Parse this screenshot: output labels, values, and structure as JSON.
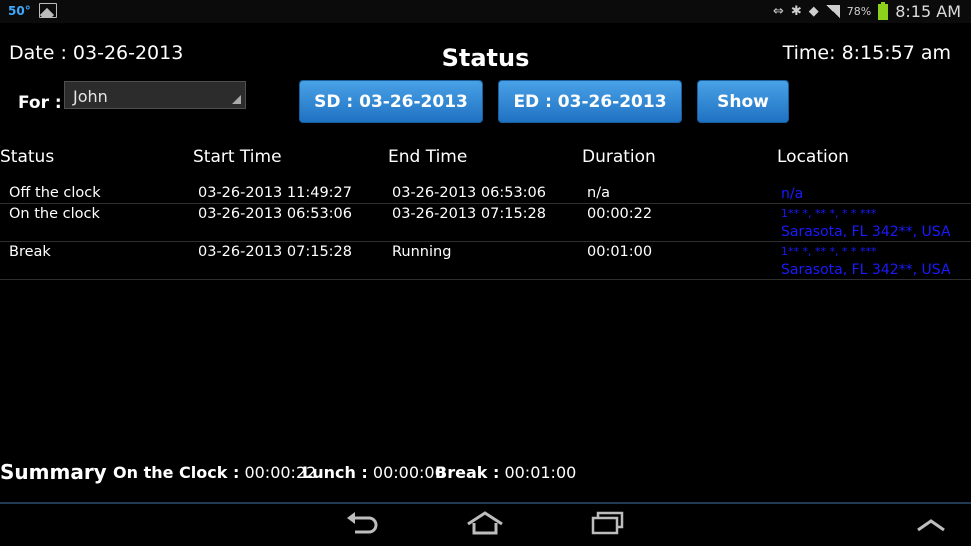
{
  "status_bar": {
    "temperature": "50°",
    "battery": "78%",
    "clock": "8:15 AM"
  },
  "header": {
    "date_label": "Date :",
    "date_value": "03-26-2013",
    "title": "Status",
    "time_label": "Time:",
    "time_value": "8:15:57 am"
  },
  "filter": {
    "for_label": "For :",
    "user_selected": "John",
    "sd_button": "SD : 03-26-2013",
    "ed_button": "ED : 03-26-2013",
    "show_button": "Show"
  },
  "table": {
    "columns": [
      "Status",
      "Start Time",
      "End Time",
      "Duration",
      "Location"
    ],
    "rows": [
      {
        "status": "Off the clock",
        "start": "03-26-2013  11:49:27",
        "end": "03-26-2013  06:53:06",
        "duration": "n/a",
        "location_line1": "n/a",
        "location_line2": ""
      },
      {
        "status": "On the clock",
        "start": "03-26-2013  06:53:06",
        "end": "03-26-2013  07:15:28",
        "duration": "00:00:22",
        "location_line1": "1** *, **  *, * * ***",
        "location_line2": "Sarasota, FL 342**, USA"
      },
      {
        "status": "Break",
        "start": "03-26-2013  07:15:28",
        "end": "Running",
        "duration": "00:01:00",
        "location_line1": "1** *, **  *, * * ***",
        "location_line2": "Sarasota, FL 342**, USA"
      }
    ]
  },
  "summary": {
    "title": "Summary",
    "on_clock_label": "On the Clock :",
    "on_clock_value": "00:00:22",
    "lunch_label": "Lunch :",
    "lunch_value": "00:00:00",
    "break_label": "Break :",
    "break_value": "00:01:00"
  },
  "nav": {
    "back_icon": "back-icon",
    "home_icon": "home-icon",
    "recents_icon": "recents-icon",
    "up_icon": "chevron-up-icon"
  },
  "colors": {
    "button_top": "#49a1e6",
    "button_bottom": "#1f72c2",
    "location_text": "#1a1aff",
    "temperature_text": "#3fa9ff",
    "battery": "#8cd21c"
  }
}
